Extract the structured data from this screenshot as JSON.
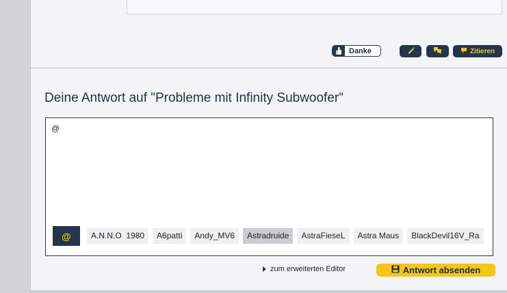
{
  "post": {
    "thanks_label": "Danke",
    "quote_label": "Zitieren"
  },
  "reply": {
    "title": "Deine Antwort auf \"Probleme mit Infinity Subwoofer\"",
    "editor_text": "@",
    "mention_symbol": "@",
    "mentions": [
      "A.N.N.O  1980",
      "A6patti",
      "Andy_MV6",
      "Astradruide",
      "AstraFieseL",
      "Astra Maus",
      "BlackDevil16V_Ra"
    ],
    "active_mention_index": 3
  },
  "footer": {
    "extended_editor_label": "zum erweiterten Editor",
    "submit_label": "Antwort absenden"
  },
  "colors": {
    "navy": "#24354d",
    "accent_yellow": "#f5c518",
    "panel_bg": "#f3f4f6"
  },
  "icons": [
    "thumbs-up-icon",
    "pencil-icon",
    "multi-quote-icon",
    "quote-icon",
    "triangle-right-icon",
    "save-icon"
  ]
}
